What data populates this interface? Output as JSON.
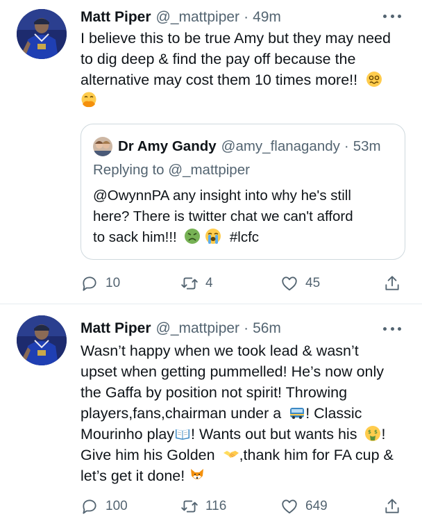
{
  "tweets": [
    {
      "author_name": "Matt Piper",
      "author_handle": "@_mattpiper",
      "separator": "·",
      "time": "49m",
      "lines": [
        "I believe this to be true Amy but they may need",
        "to dig deep & find the pay off because the",
        "alternative may cost them 10 times more!!"
      ],
      "quoted": {
        "author_name": "Dr Amy Gandy",
        "author_handle": "@amy_flanagandy",
        "separator": "·",
        "time": "53m",
        "replying_prefix": "Replying to",
        "replying_handle": "@_mattpiper",
        "lines": [
          "@OwynnPA any insight into why he's still",
          "here? There is twitter chat we can't afford",
          "to sack him!!!",
          "#lcfc"
        ]
      },
      "stats": {
        "replies": "10",
        "retweets": "4",
        "likes": "45"
      }
    },
    {
      "author_name": "Matt Piper",
      "author_handle": "@_mattpiper",
      "separator": "·",
      "time": "56m",
      "lines": [
        "Wasn’t happy when we took lead & wasn’t",
        "upset when getting pummelled! He’s now only",
        "the Gaffa by position not spirit! Throwing",
        "players,fans,chairman under a",
        "! Classic",
        "Mourinho play",
        "! Wants out but wants his",
        "!",
        "Give him his Golden",
        ",thank him for FA cup &",
        "let’s get it done!"
      ],
      "stats": {
        "replies": "100",
        "retweets": "116",
        "likes": "649"
      }
    }
  ],
  "icons": {
    "more": "more-horizontal-icon",
    "reply": "reply-icon",
    "retweet": "retweet-icon",
    "like": "heart-icon",
    "share": "share-icon",
    "emojis_tweet1": [
      "woozy-face-emoji",
      "face-with-hand-over-mouth-emoji"
    ],
    "emojis_quote": [
      "nauseated-face-emoji",
      "loudly-crying-face-emoji"
    ],
    "emojis_tweet2": [
      "bus-emoji",
      "open-book-emoji",
      "money-mouth-face-emoji",
      "handshake-emoji",
      "fox-emoji"
    ]
  },
  "colors": {
    "text": "#0f1419",
    "secondary": "#536471",
    "border": "#cfd9de",
    "divider": "#e6ecf0",
    "avatar_bg": "#1d2b6e"
  }
}
